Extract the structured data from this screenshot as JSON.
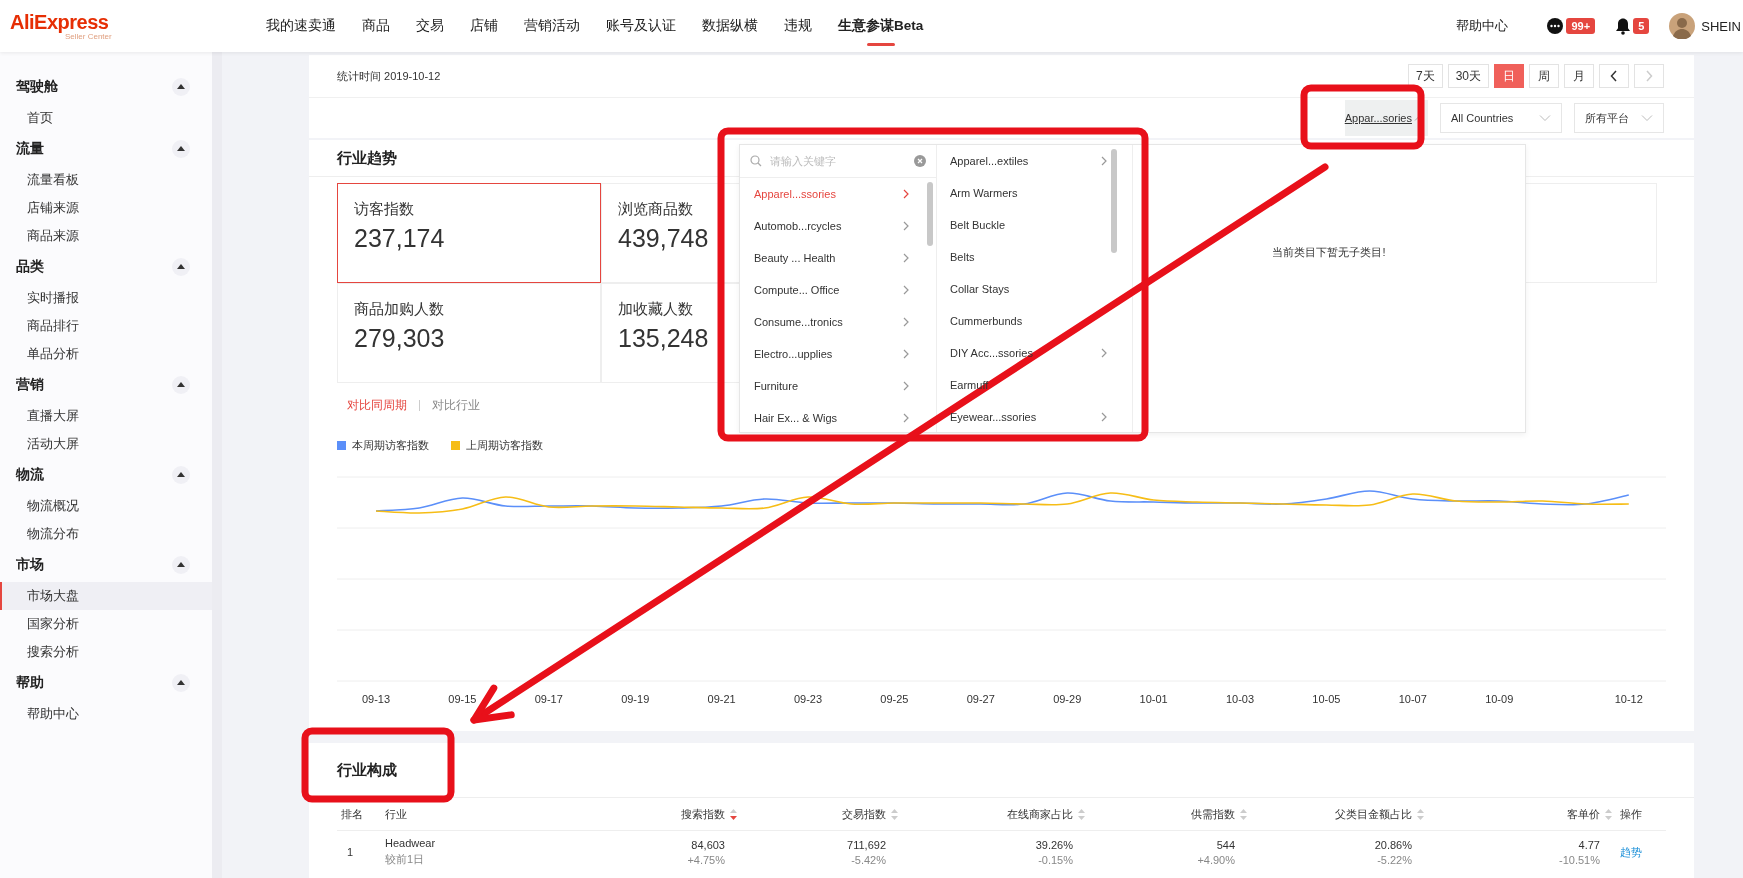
{
  "header": {
    "logo": "AliExpress",
    "logo_sub": "Seller Center",
    "nav": [
      {
        "label": "我的速卖通",
        "selected": false
      },
      {
        "label": "商品",
        "selected": false
      },
      {
        "label": "交易",
        "selected": false
      },
      {
        "label": "店铺",
        "selected": false
      },
      {
        "label": "营销活动",
        "selected": false
      },
      {
        "label": "账号及认证",
        "selected": false
      },
      {
        "label": "数据纵横",
        "selected": false
      },
      {
        "label": "违规",
        "selected": false
      },
      {
        "label": "生意参谋Beta",
        "selected": true
      }
    ],
    "help": "帮助中心",
    "messages_badge": "99+",
    "notifications_badge": "5",
    "user": "SHEIN"
  },
  "sidebar": {
    "groups": [
      {
        "title": "驾驶舱",
        "expanded": true,
        "items": [
          {
            "label": "首页",
            "selected": false
          }
        ]
      },
      {
        "title": "流量",
        "expanded": true,
        "items": [
          {
            "label": "流量看板",
            "selected": false
          },
          {
            "label": "店铺来源",
            "selected": false
          },
          {
            "label": "商品来源",
            "selected": false
          }
        ]
      },
      {
        "title": "品类",
        "expanded": true,
        "items": [
          {
            "label": "实时播报",
            "selected": false
          },
          {
            "label": "商品排行",
            "selected": false
          },
          {
            "label": "单品分析",
            "selected": false
          }
        ]
      },
      {
        "title": "营销",
        "expanded": true,
        "items": [
          {
            "label": "直播大屏",
            "selected": false
          },
          {
            "label": "活动大屏",
            "selected": false
          }
        ]
      },
      {
        "title": "物流",
        "expanded": true,
        "items": [
          {
            "label": "物流概况",
            "selected": false
          },
          {
            "label": "物流分布",
            "selected": false
          }
        ]
      },
      {
        "title": "市场",
        "expanded": true,
        "items": [
          {
            "label": "市场大盘",
            "selected": true
          },
          {
            "label": "国家分析",
            "selected": false
          },
          {
            "label": "搜索分析",
            "selected": false
          }
        ]
      },
      {
        "title": "帮助",
        "expanded": true,
        "items": [
          {
            "label": "帮助中心",
            "selected": false
          }
        ]
      }
    ]
  },
  "toolbar": {
    "stat_time": "统计时间 2019-10-12",
    "periods": [
      {
        "label": "7天",
        "selected": false
      },
      {
        "label": "30天",
        "selected": false
      },
      {
        "label": "日",
        "selected": true
      },
      {
        "label": "周",
        "selected": false
      },
      {
        "label": "月",
        "selected": false
      }
    ],
    "prev_disabled": false,
    "next_disabled": true
  },
  "filters": {
    "category": {
      "value": "Appar...sories",
      "open": true
    },
    "country": "All Countries",
    "platform": "所有平台"
  },
  "trend": {
    "title": "行业趋势",
    "metrics": [
      {
        "label": "访客指数",
        "value": "237,174",
        "selected": true
      },
      {
        "label": "浏览商品数",
        "value": "439,748",
        "selected": false
      },
      {
        "label": "商品加购人数",
        "value": "279,303",
        "selected": false
      },
      {
        "label": "加收藏人数",
        "value": "135,248",
        "selected": false
      }
    ],
    "compare_tabs": [
      {
        "label": "对比同周期",
        "selected": true
      },
      {
        "label": "对比行业",
        "selected": false
      }
    ],
    "legend": [
      {
        "name": "本周期访客指数",
        "color": "#5b8ff9"
      },
      {
        "name": "上周期访客指数",
        "color": "#f6bd16"
      }
    ],
    "x_labels": [
      "09-13",
      "09-15",
      "09-17",
      "09-19",
      "09-21",
      "09-23",
      "09-25",
      "09-27",
      "09-29",
      "10-01",
      "10-03",
      "10-05",
      "10-07",
      "10-09",
      "10-12"
    ]
  },
  "category_dropdown": {
    "placeholder": "请输入关键字",
    "level1": [
      {
        "label": "Apparel...ssories",
        "selected": true,
        "has_children": true
      },
      {
        "label": "Automob...rcycles",
        "selected": false,
        "has_children": true
      },
      {
        "label": "Beauty ... Health",
        "selected": false,
        "has_children": true
      },
      {
        "label": "Compute... Office",
        "selected": false,
        "has_children": true
      },
      {
        "label": "Consume...tronics",
        "selected": false,
        "has_children": true
      },
      {
        "label": "Electro...upplies",
        "selected": false,
        "has_children": true
      },
      {
        "label": "Furniture",
        "selected": false,
        "has_children": true
      },
      {
        "label": "Hair Ex... & Wigs",
        "selected": false,
        "has_children": true
      }
    ],
    "level2": [
      {
        "label": "Apparel...extiles",
        "has_children": true
      },
      {
        "label": "Arm Warmers",
        "has_children": false
      },
      {
        "label": "Belt Buckle",
        "has_children": false
      },
      {
        "label": "Belts",
        "has_children": false
      },
      {
        "label": "Collar Stays",
        "has_children": false
      },
      {
        "label": "Cummerbunds",
        "has_children": false
      },
      {
        "label": "DIY Acc...ssories",
        "has_children": true
      },
      {
        "label": "Earmuff",
        "has_children": false
      },
      {
        "label": "Eyewear...ssories",
        "has_children": true
      }
    ],
    "empty_message": "当前类目下暂无子类目!"
  },
  "composition": {
    "title": "行业构成",
    "columns": [
      {
        "label": "排名"
      },
      {
        "label": "行业"
      },
      {
        "label": "搜索指数",
        "sorted": true
      },
      {
        "label": "交易指数",
        "sorted": false
      },
      {
        "label": "在线商家占比",
        "sorted": false
      },
      {
        "label": "供需指数",
        "sorted": false
      },
      {
        "label": "父类目金额占比",
        "sorted": false
      },
      {
        "label": "客单价",
        "sorted": false
      },
      {
        "label": "操作"
      }
    ],
    "rows": [
      {
        "cells": [
          {
            "main": "1"
          },
          {
            "main": "Headwear",
            "sub": "较前1日"
          },
          {
            "main": "84,603",
            "sub": "+4.75%"
          },
          {
            "main": "711,692",
            "sub": "-5.42%"
          },
          {
            "main": "39.26%",
            "sub": "-0.15%"
          },
          {
            "main": "544",
            "sub": "+4.90%"
          },
          {
            "main": "20.86%",
            "sub": "-5.22%"
          },
          {
            "main": "4.77",
            "sub": "-10.51%"
          },
          {
            "main": "趋势",
            "kind": "link"
          }
        ]
      }
    ]
  }
}
